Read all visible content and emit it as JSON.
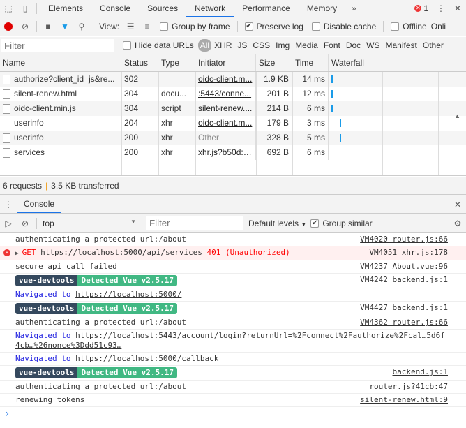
{
  "tabs": {
    "items": [
      "Elements",
      "Console",
      "Sources",
      "Network",
      "Performance",
      "Memory"
    ],
    "active": "Network",
    "error_count": "1"
  },
  "toolbar": {
    "view_label": "View:",
    "group_by_frame": "Group by frame",
    "preserve_log": "Preserve log",
    "disable_cache": "Disable cache",
    "offline": "Offline",
    "online": "Onli",
    "preserve_log_checked": true
  },
  "filters": {
    "placeholder": "Filter",
    "hide_data_urls": "Hide data URLs",
    "types": [
      "All",
      "XHR",
      "JS",
      "CSS",
      "Img",
      "Media",
      "Font",
      "Doc",
      "WS",
      "Manifest",
      "Other"
    ]
  },
  "table": {
    "headers": [
      "Name",
      "Status",
      "Type",
      "Initiator",
      "Size",
      "Time",
      "Waterfall"
    ],
    "rows": [
      {
        "name": "authorize?client_id=js&re...",
        "status": "302",
        "type": "",
        "initiator": "oidc-client.m...",
        "size": "1.9 KB",
        "time": "14 ms"
      },
      {
        "name": "silent-renew.html",
        "status": "304",
        "type": "docu...",
        "initiator": ":5443/conne...",
        "size": "201 B",
        "time": "12 ms"
      },
      {
        "name": "oidc-client.min.js",
        "status": "304",
        "type": "script",
        "initiator": "silent-renew....",
        "size": "214 B",
        "time": "6 ms"
      },
      {
        "name": "userinfo",
        "status": "204",
        "type": "xhr",
        "initiator": "oidc-client.m...",
        "size": "179 B",
        "time": "3 ms"
      },
      {
        "name": "userinfo",
        "status": "200",
        "type": "xhr",
        "initiator": "Other",
        "size": "328 B",
        "time": "5 ms"
      },
      {
        "name": "services",
        "status": "200",
        "type": "xhr",
        "initiator": "xhr.js?b50d:1...",
        "size": "692 B",
        "time": "6 ms"
      }
    ]
  },
  "summary": {
    "requests": "6 requests",
    "transferred": "3.5 KB transferred"
  },
  "drawer": {
    "tab": "Console"
  },
  "console_toolbar": {
    "context": "top",
    "filter_placeholder": "Filter",
    "levels": "Default levels",
    "group_similar": "Group similar"
  },
  "messages": [
    {
      "kind": "log",
      "text": "authenticating a protected url:/about",
      "source": "VM4020 router.js:66"
    },
    {
      "kind": "error",
      "prefix": "GET ",
      "url": "https://localhost:5000/api/services",
      "suffix": " 401 (Unauthorized)",
      "source": "VM4051 xhr.js:178"
    },
    {
      "kind": "log",
      "text": "secure api call failed",
      "source": "VM4237 About.vue:96"
    },
    {
      "kind": "vue",
      "a": "vue-devtools",
      "b": "Detected Vue v2.5.17",
      "source": "VM4242 backend.js:1"
    },
    {
      "kind": "nav",
      "prefix": "Navigated to ",
      "url": "https://localhost:5000/",
      "source": ""
    },
    {
      "kind": "vue",
      "a": "vue-devtools",
      "b": "Detected Vue v2.5.17",
      "source": "VM4427 backend.js:1"
    },
    {
      "kind": "log",
      "text": "authenticating a protected url:/about",
      "source": "VM4362 router.js:66"
    },
    {
      "kind": "nav",
      "prefix": "Navigated to ",
      "url": "https://localhost:5443/account/login?returnUrl=%2Fconnect%2Fauthorize%2Fcal…5d6f4cb…%26nonce%3Ddd51c93…",
      "source": ""
    },
    {
      "kind": "nav",
      "prefix": "Navigated to ",
      "url": "https://localhost:5000/callback",
      "source": ""
    },
    {
      "kind": "vue",
      "a": "vue-devtools",
      "b": "Detected Vue v2.5.17",
      "source": "backend.js:1"
    },
    {
      "kind": "log",
      "text": "authenticating a protected url:/about",
      "source": "router.js?41cb:47"
    },
    {
      "kind": "log",
      "text": "renewing tokens",
      "source": "silent-renew.html:9"
    }
  ],
  "colors": {
    "accent": "#1a73e8",
    "record": "#e00000",
    "filter_active": "#1a9be8",
    "vue_dark": "#35495e",
    "vue_green": "#41b883",
    "error": "#ff0000"
  }
}
